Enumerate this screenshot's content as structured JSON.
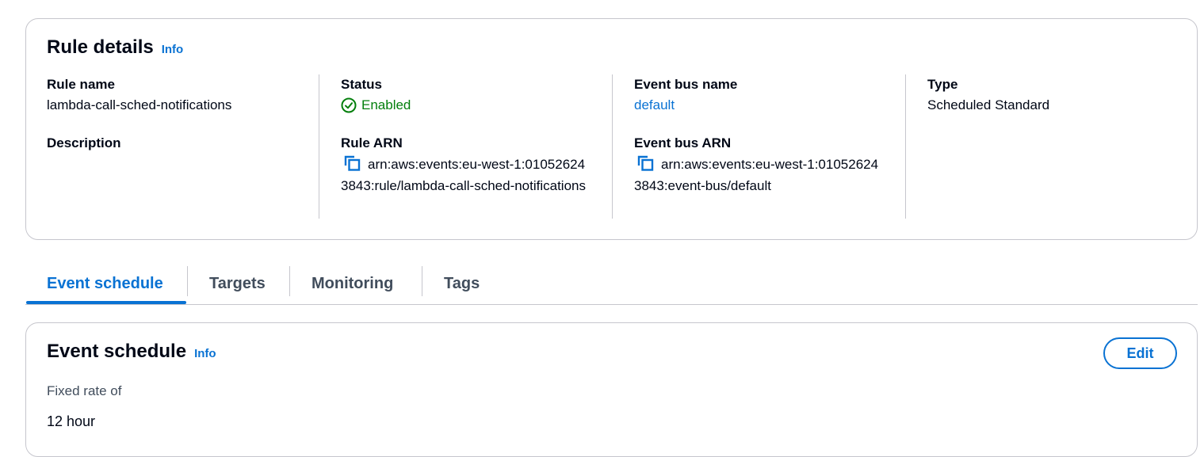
{
  "rule_details": {
    "title": "Rule details",
    "info_label": "Info",
    "rule_name_label": "Rule name",
    "rule_name_value": "lambda-call-sched-notifications",
    "description_label": "Description",
    "status_label": "Status",
    "status_value": "Enabled",
    "rule_arn_label": "Rule ARN",
    "rule_arn_value": "arn:aws:events:eu-west-1:010526243843:rule/lambda-call-sched-notifications",
    "event_bus_name_label": "Event bus name",
    "event_bus_name_value": "default",
    "event_bus_arn_label": "Event bus ARN",
    "event_bus_arn_value": "arn:aws:events:eu-west-1:010526243843:event-bus/default",
    "type_label": "Type",
    "type_value": "Scheduled Standard"
  },
  "tabs": [
    {
      "label": "Event schedule",
      "active": true
    },
    {
      "label": "Targets",
      "active": false
    },
    {
      "label": "Monitoring",
      "active": false
    },
    {
      "label": "Tags",
      "active": false
    }
  ],
  "event_schedule": {
    "title": "Event schedule",
    "info_label": "Info",
    "edit_label": "Edit",
    "rate_label": "Fixed rate of",
    "rate_value": "12 hour"
  },
  "colors": {
    "accent": "#0972d3",
    "success": "#037f0c",
    "border": "#c6c6cd",
    "text": "#000716"
  },
  "icons": {
    "status": "check-circle-icon",
    "copy": "copy-icon"
  }
}
